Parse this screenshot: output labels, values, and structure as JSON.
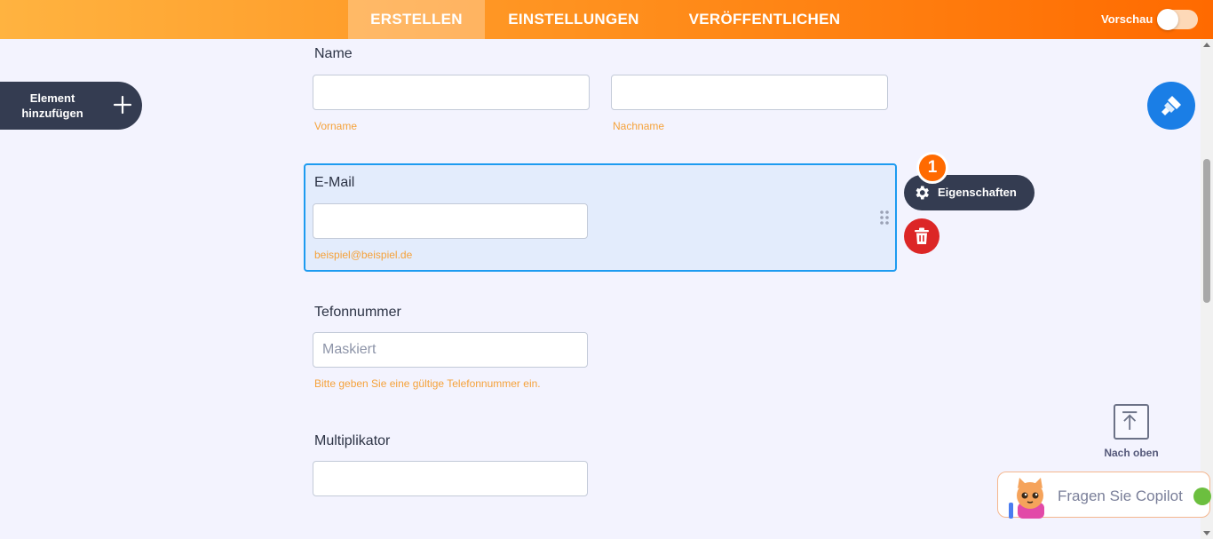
{
  "header": {
    "tabs": [
      {
        "label": "ERSTELLEN",
        "active": true
      },
      {
        "label": "EINSTELLUNGEN",
        "active": false
      },
      {
        "label": "VERÖFFENTLICHEN",
        "active": false
      }
    ],
    "preview_label": "Vorschau",
    "preview_enabled": false
  },
  "sidebar": {
    "add_element_label": "Element hinzufügen"
  },
  "form": {
    "name": {
      "label": "Name",
      "first_sublabel": "Vorname",
      "last_sublabel": "Nachname",
      "first_value": "",
      "last_value": ""
    },
    "email": {
      "label": "E-Mail",
      "value": "",
      "sublabel": "beispiel@beispiel.de"
    },
    "phone": {
      "label": "Tefonnummer",
      "placeholder": "Maskiert",
      "sublabel": "Bitte geben Sie eine gültige Telefonnummer ein."
    },
    "multiplier": {
      "label": "Multiplikator",
      "value": ""
    }
  },
  "toolbar": {
    "properties_label": "Eigenschaften",
    "badge": "1"
  },
  "to_top_label": "Nach oben",
  "copilot_label": "Fragen Sie Copilot",
  "colors": {
    "accent": "#ff8c1a",
    "selected_border": "#1d9bf0",
    "delete": "#dc2626",
    "dark": "#343c51",
    "sublabel": "#f5a23b"
  },
  "icons": {
    "add": "plus-icon",
    "properties": "gear-icon",
    "delete": "trash-icon",
    "design": "paint-roller-icon",
    "drag": "drag-handle-icon",
    "to_top": "arrow-up-icon"
  }
}
